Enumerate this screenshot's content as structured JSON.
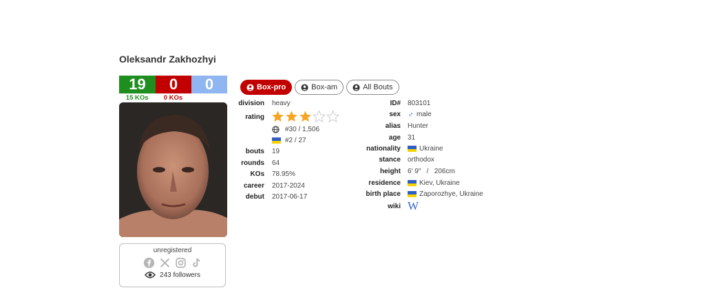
{
  "boxer": {
    "name": "Oleksandr Zakhozhyi"
  },
  "record": {
    "wins": "19",
    "losses": "0",
    "draws": "0",
    "wins_ko": "15 KOs",
    "losses_ko": "0 KOs"
  },
  "social": {
    "status": "unregistered",
    "followers": "243 followers",
    "icons": [
      "facebook-icon",
      "x-icon",
      "instagram-icon",
      "tiktok-icon"
    ]
  },
  "tabs": [
    {
      "label": "Box-pro",
      "active": true
    },
    {
      "label": "Box-am",
      "active": false
    },
    {
      "label": "All Bouts",
      "active": false
    }
  ],
  "rating": {
    "stars": 3,
    "max_stars": 5,
    "world_rank": "#30 / 1,506",
    "country_rank": "#2 / 27"
  },
  "left_info": {
    "division": {
      "label": "division",
      "value": "heavy"
    },
    "rating_label": "rating",
    "bouts": {
      "label": "bouts",
      "value": "19"
    },
    "rounds": {
      "label": "rounds",
      "value": "64"
    },
    "kos": {
      "label": "KOs",
      "value": "78.95%"
    },
    "career": {
      "label": "career",
      "value": "2017-2024"
    },
    "debut": {
      "label": "debut",
      "value": "2017-06-17"
    }
  },
  "right_info": {
    "id": {
      "label": "ID#",
      "value": "803101"
    },
    "sex": {
      "label": "sex",
      "value": "male"
    },
    "alias": {
      "label": "alias",
      "value": "Hunter"
    },
    "age": {
      "label": "age",
      "value": "31"
    },
    "nationality": {
      "label": "nationality",
      "value": "Ukraine"
    },
    "stance": {
      "label": "stance",
      "value": "orthodox"
    },
    "height": {
      "label": "height",
      "value": "6′ 9″   /   206cm"
    },
    "residence": {
      "label": "residence",
      "value": "Kiev, Ukraine"
    },
    "birth_place": {
      "label": "birth place",
      "value": "Zaporozhye, Ukraine"
    },
    "wiki": {
      "label": "wiki"
    }
  },
  "colors": {
    "win": "#1e8e1e",
    "loss": "#c20000",
    "draw": "#8fb6f0",
    "star": "#f5a623",
    "flag_blue": "#2f5fc4",
    "flag_yellow": "#f5d300"
  }
}
